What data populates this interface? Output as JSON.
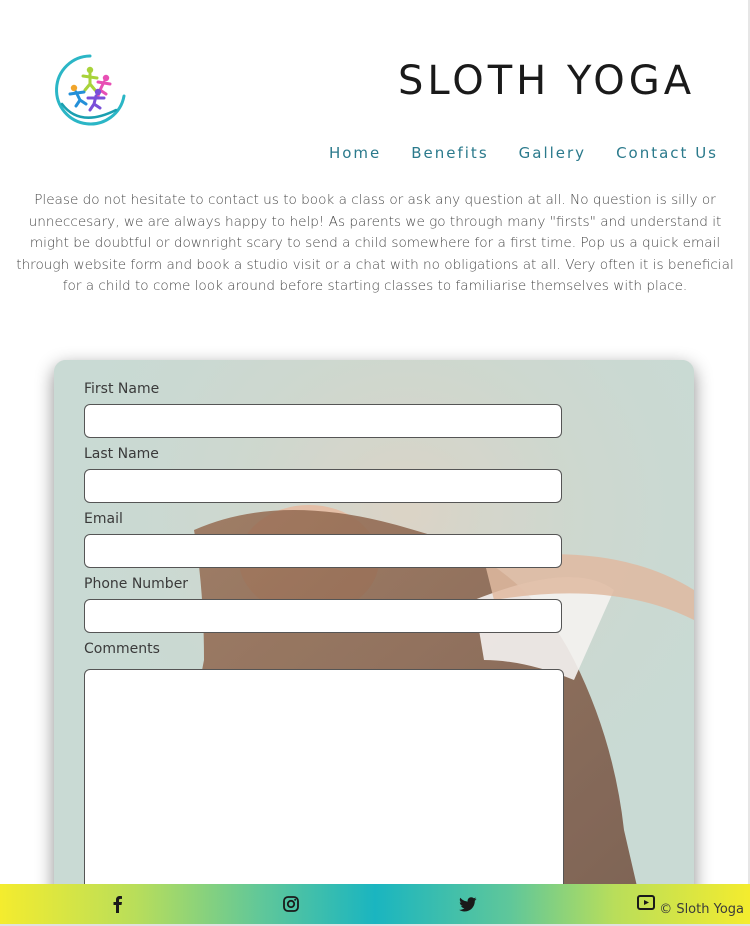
{
  "brand": {
    "title": "SLOTH YOGA",
    "logo_icon": "people-circle-logo"
  },
  "nav": {
    "items": [
      {
        "label": "Home"
      },
      {
        "label": "Benefits"
      },
      {
        "label": "Gallery"
      },
      {
        "label": "Contact Us"
      }
    ]
  },
  "intro": {
    "text": "Please do not hesitate to contact us to book a class or ask any question at all. No question is silly or unneccesary, we are always happy to help! As parents we go through many \"firsts\" and understand it might be doubtful or downright scary to send a child somewhere for a first time. Pop us a quick email through website form and book a studio visit or a chat with no obligations at all. Very often it is beneficial for a child to come look around before starting classes to familiarise themselves with place."
  },
  "form": {
    "first_name_label": "First Name",
    "last_name_label": "Last Name",
    "email_label": "Email",
    "phone_label": "Phone Number",
    "comments_label": "Comments",
    "first_name_value": "",
    "last_name_value": "",
    "email_value": "",
    "phone_value": "",
    "comments_value": ""
  },
  "footer": {
    "copyright": "© Sloth Yoga",
    "social": [
      "facebook-icon",
      "instagram-icon",
      "twitter-icon",
      "youtube-icon"
    ]
  },
  "colors": {
    "nav_link": "#2b7a8c",
    "footer_gradient": [
      "#f4ec2e",
      "#1ab5c0"
    ]
  }
}
